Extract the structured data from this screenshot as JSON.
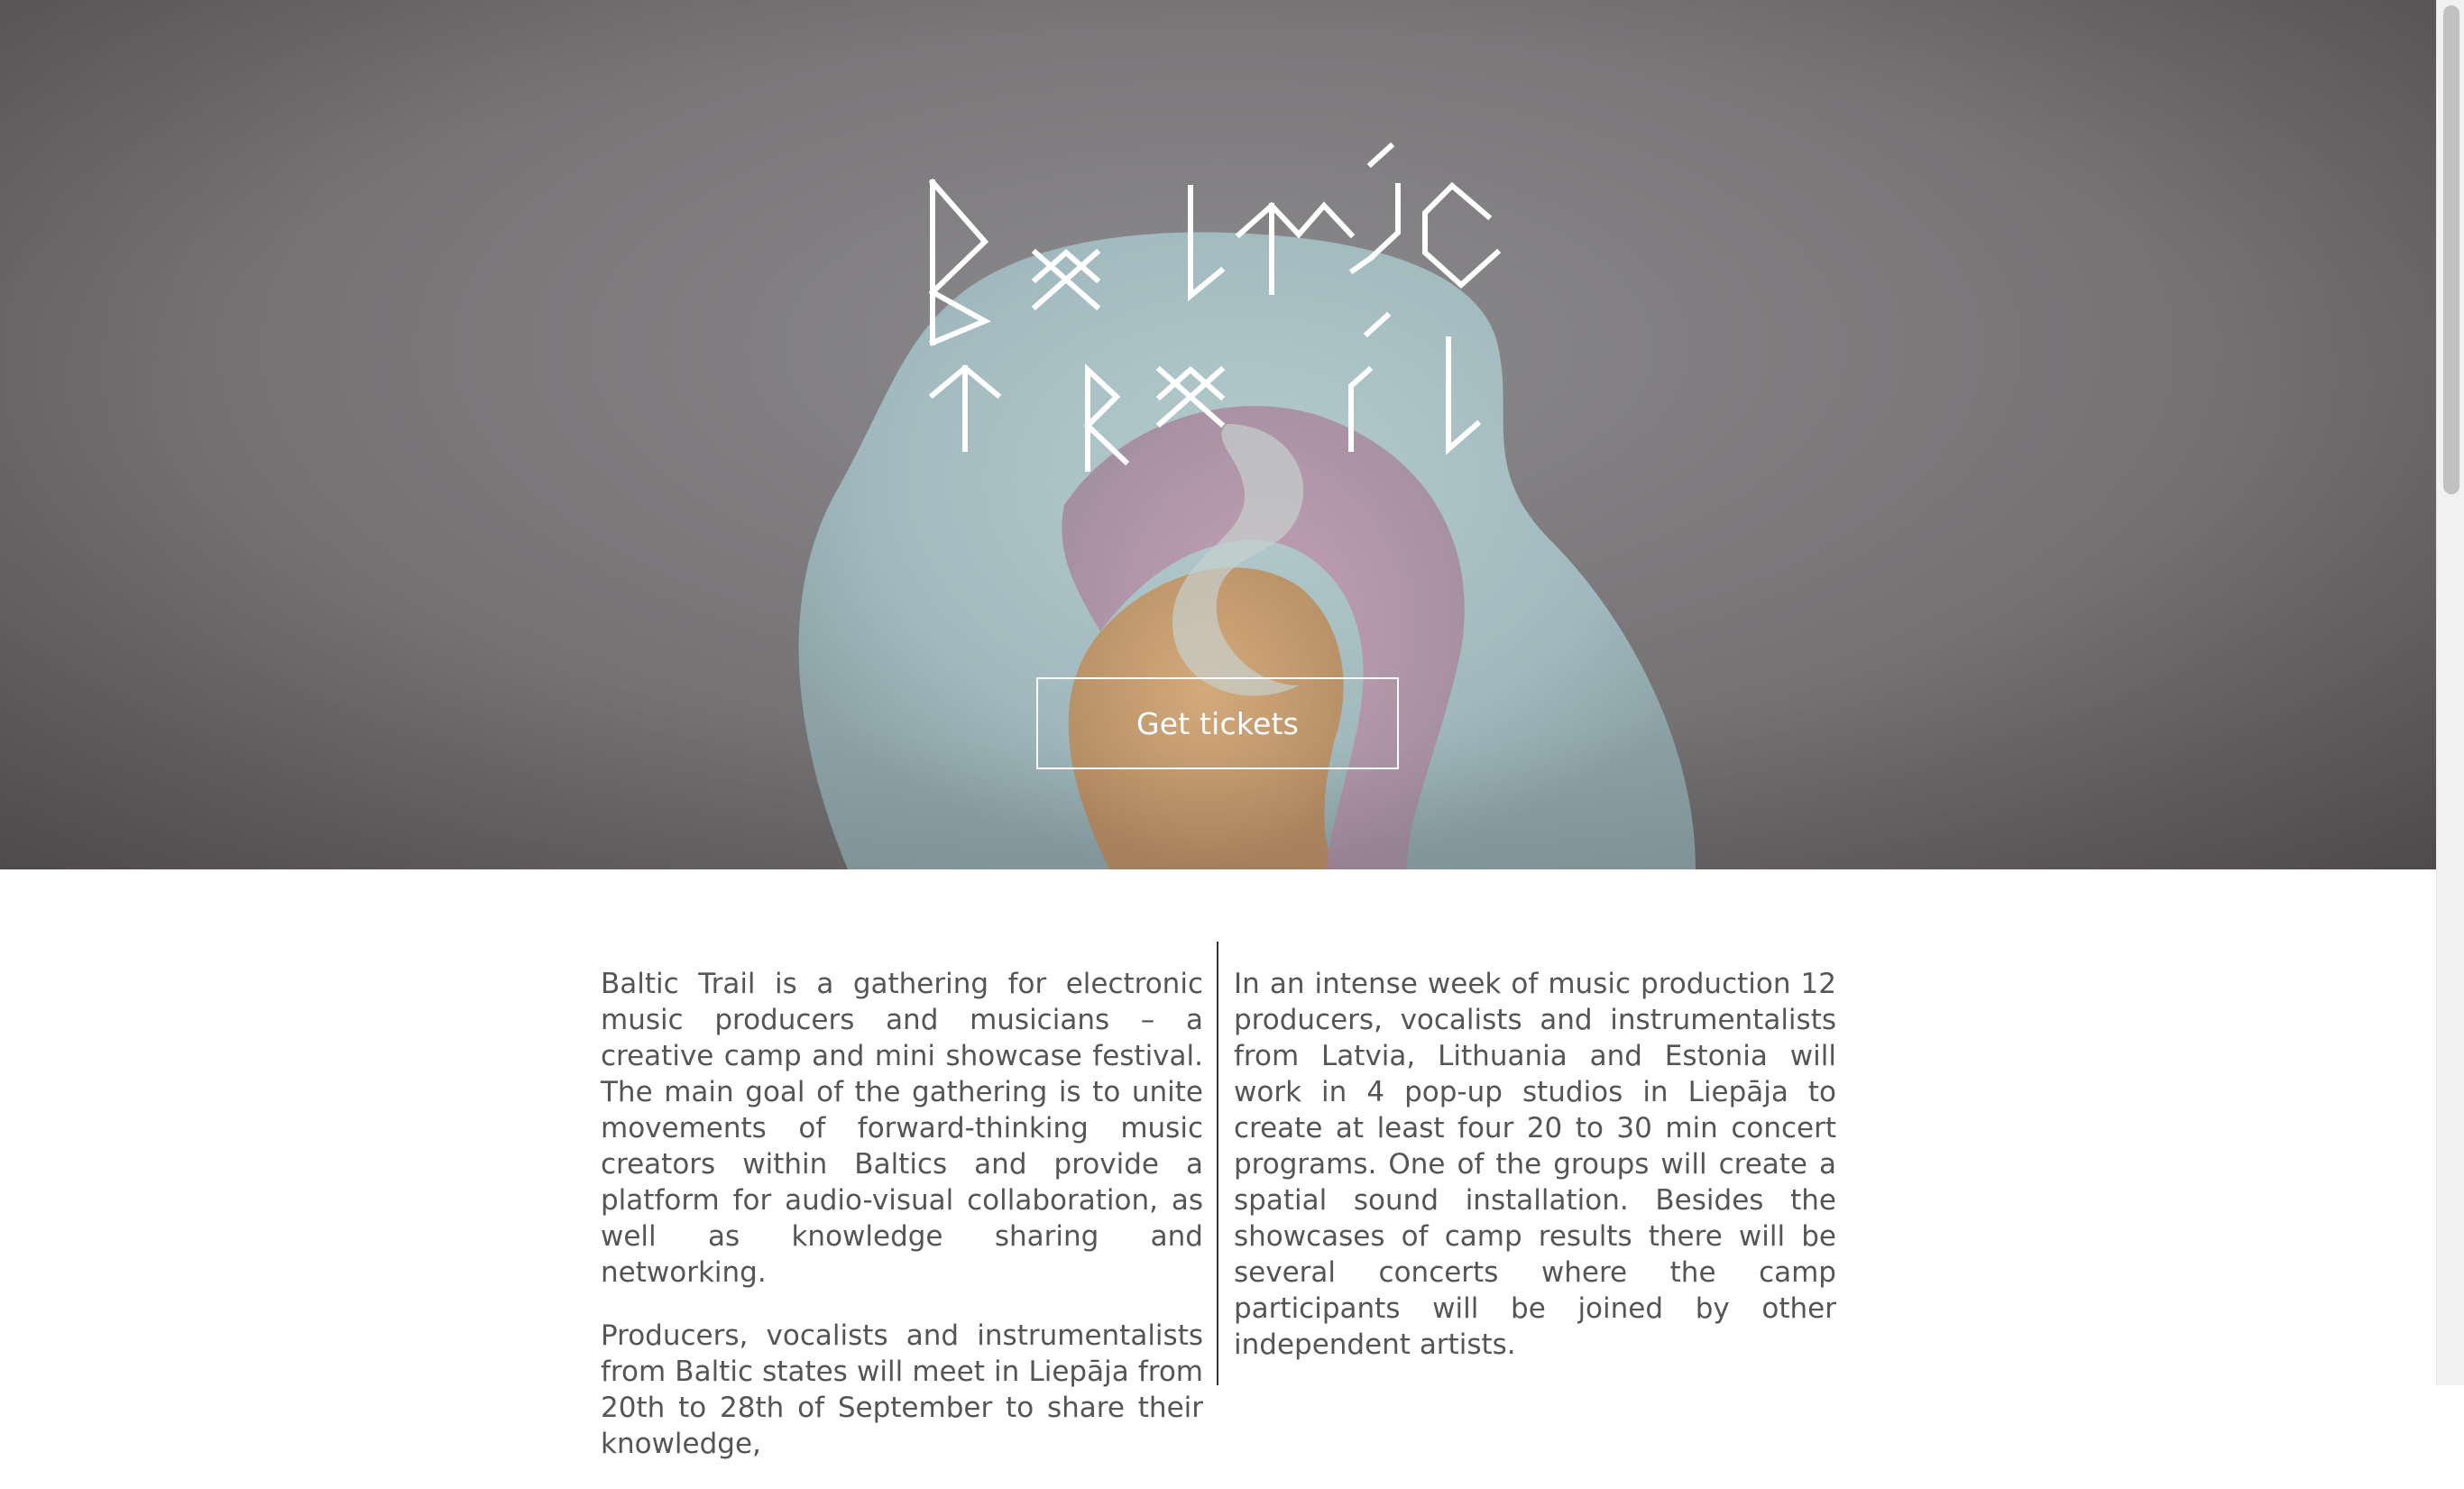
{
  "hero": {
    "logo_name": "Baltic Trail",
    "cta_label": "Get tickets"
  },
  "intro": {
    "left_paragraphs": [
      "Baltic Trail is a gathering for electronic music producers and musicians – a creative camp and mini showcase festival. The main goal of the gathering is to unite movements of forward-thinking music creators within Baltics and provide a platform for audio-visual collaboration, as well as knowledge sharing and networking.",
      "Producers, vocalists and instrumentalists from Baltic states will meet in Liepāja from 20th to 28th of September to share their knowledge,"
    ],
    "right_paragraphs": [
      "In an intense week of music production 12 producers, vocalists and instrumentalists from Latvia, Lithuania and Estonia will work in 4 pop-up studios in Liepāja to create at least four 20 to 30 min concert programs. One of the groups will create a spatial sound installation. Besides the showcases of camp results there will be several concerts where the camp participants will be joined by other independent artists."
    ]
  },
  "colors": {
    "hero_bg": "#767375",
    "text": "#555555",
    "divider": "#333333",
    "button_border": "#ffffff"
  }
}
